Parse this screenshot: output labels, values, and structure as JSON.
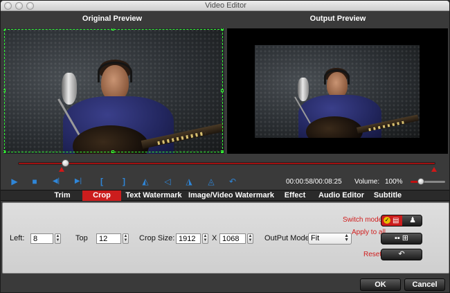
{
  "window": {
    "title": "Video Editor"
  },
  "preview": {
    "original_label": "Original Preview",
    "output_label": "Output Preview"
  },
  "playback": {
    "progress": 0.117,
    "time": "00:00:58/00:08:25",
    "volume_label": "Volume:",
    "volume_value": "100%",
    "volume_level": 0.2
  },
  "tabs": [
    {
      "label": "Trim",
      "active": false
    },
    {
      "label": "Crop",
      "active": true
    },
    {
      "label": "Text Watermark",
      "active": false
    },
    {
      "label": "Image/Video Watermark",
      "active": false
    },
    {
      "label": "Effect",
      "active": false
    },
    {
      "label": "Audio Editor",
      "active": false
    },
    {
      "label": "Subtitle",
      "active": false
    }
  ],
  "crop": {
    "left_label": "Left:",
    "left_value": "8",
    "top_label": "Top",
    "top_value": "12",
    "size_label": "Crop Size:",
    "width_value": "1912",
    "x_sep": "X",
    "height_value": "1068",
    "output_mode_label": "OutPut Mode",
    "output_mode_value": "Fit",
    "switch_mode_label": "Switch mode",
    "apply_all_label": "Apply to all",
    "reset_label": "Reset"
  },
  "buttons": {
    "ok": "OK",
    "cancel": "Cancel"
  },
  "colors": {
    "accent": "#cc1d1d",
    "crop_border": "#33ff33",
    "icon_blue": "#2f86d8"
  },
  "icons": [
    "play-icon",
    "stop-icon",
    "mark-in-icon",
    "mark-out-icon",
    "bracket-left-icon",
    "bracket-right-icon",
    "flip-horizontal-icon",
    "flip-left-icon",
    "flip-vertical-icon",
    "rotate-icon",
    "undo-icon"
  ]
}
